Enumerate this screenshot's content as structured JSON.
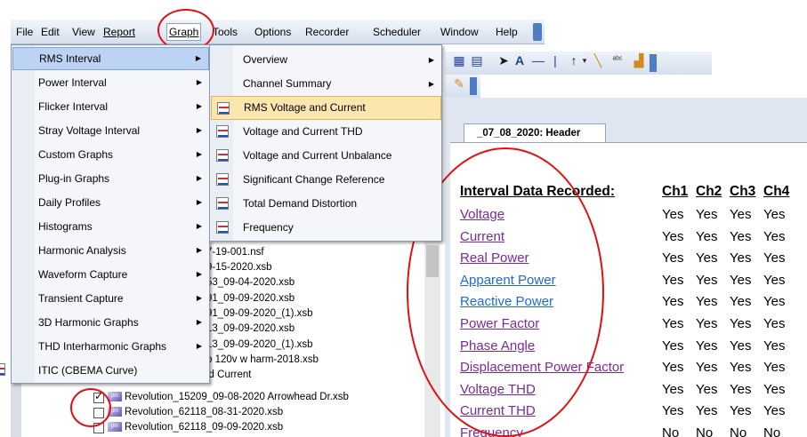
{
  "menubar": {
    "items": [
      {
        "label": "File"
      },
      {
        "label": "Edit"
      },
      {
        "label": "View"
      },
      {
        "label": "Report"
      },
      {
        "label": "Graph"
      },
      {
        "label": "Tools"
      },
      {
        "label": "Options"
      },
      {
        "label": "Recorder"
      },
      {
        "label": "Scheduler"
      },
      {
        "label": "Window"
      },
      {
        "label": "Help"
      }
    ]
  },
  "graph_menu": {
    "items": [
      {
        "label": "RMS Interval",
        "submenu": true
      },
      {
        "label": "Power Interval",
        "submenu": true
      },
      {
        "label": "Flicker Interval",
        "submenu": true
      },
      {
        "label": "Stray Voltage Interval",
        "submenu": true
      },
      {
        "label": "Custom Graphs",
        "submenu": true
      },
      {
        "label": "Plug-in Graphs",
        "submenu": true
      },
      {
        "label": "Daily Profiles",
        "submenu": true
      },
      {
        "label": "Histograms",
        "submenu": true
      },
      {
        "label": "Harmonic Analysis",
        "submenu": true
      },
      {
        "label": "Waveform Capture",
        "submenu": true
      },
      {
        "label": "Transient Capture",
        "submenu": true
      },
      {
        "label": "3D Harmonic Graphs",
        "submenu": true
      },
      {
        "label": "THD Interharmonic Graphs",
        "submenu": true
      },
      {
        "label": "ITIC (CBEMA Curve)",
        "submenu": false
      }
    ]
  },
  "rms_submenu": {
    "items": [
      {
        "label": "Overview",
        "submenu": true
      },
      {
        "label": "Channel Summary",
        "submenu": true
      },
      {
        "label": "RMS Voltage and Current"
      },
      {
        "label": "Voltage and Current THD"
      },
      {
        "label": "Voltage and Current Unbalance"
      },
      {
        "label": "Significant Change Reference"
      },
      {
        "label": "Total Demand Distortion"
      },
      {
        "label": "Frequency"
      }
    ]
  },
  "file_list": {
    "partial": [
      "7-19-001.nsf",
      "9-15-2020.xsb",
      "53_09-04-2020.xsb",
      "91_09-09-2020.xsb",
      "91_09-09-2020_(1).xsb",
      "13_09-09-2020.xsb",
      "13_09-09-2020_(1).xsb",
      "b 120v w harm-2018.xsb",
      "id Current"
    ],
    "files": [
      {
        "name": "Revolution_15209_09-08-2020 Arrowhead Dr.xsb",
        "checked": true
      },
      {
        "name": "Revolution_62118_08-31-2020.xsb",
        "checked": false
      },
      {
        "name": "Revolution_62118_09-09-2020.xsb",
        "checked": false
      }
    ]
  },
  "document": {
    "tab_label": "_07_08_2020: Header",
    "header": "Interval Data Recorded:",
    "channels": [
      "Ch1",
      "Ch2",
      "Ch3",
      "Ch4"
    ],
    "rows": [
      {
        "name": "Voltage",
        "values": [
          "Yes",
          "Yes",
          "Yes",
          "Yes"
        ]
      },
      {
        "name": "Current",
        "values": [
          "Yes",
          "Yes",
          "Yes",
          "Yes"
        ]
      },
      {
        "name": "Real Power",
        "values": [
          "Yes",
          "Yes",
          "Yes",
          "Yes"
        ]
      },
      {
        "name": "Apparent Power",
        "values": [
          "Yes",
          "Yes",
          "Yes",
          "Yes"
        ]
      },
      {
        "name": "Reactive Power",
        "values": [
          "Yes",
          "Yes",
          "Yes",
          "Yes"
        ]
      },
      {
        "name": "Power Factor",
        "values": [
          "Yes",
          "Yes",
          "Yes",
          "Yes"
        ]
      },
      {
        "name": "Phase Angle",
        "values": [
          "Yes",
          "Yes",
          "Yes",
          "Yes"
        ]
      },
      {
        "name": "Displacement Power Factor",
        "values": [
          "Yes",
          "Yes",
          "Yes",
          "Yes"
        ]
      },
      {
        "name": "Voltage THD",
        "values": [
          "Yes",
          "Yes",
          "Yes",
          "Yes"
        ]
      },
      {
        "name": "Current THD",
        "values": [
          "Yes",
          "Yes",
          "Yes",
          "Yes"
        ]
      },
      {
        "name": "Frequency",
        "values": [
          "No",
          "No",
          "No",
          "No"
        ]
      }
    ]
  },
  "colors": {
    "annotation_circle": "#e01010",
    "link_purple": "#7a2a9a",
    "link_blue": "#1f6ad6",
    "menu_highlight": "#bdd3f3",
    "submenu_highlight": "#fbe6b0"
  }
}
